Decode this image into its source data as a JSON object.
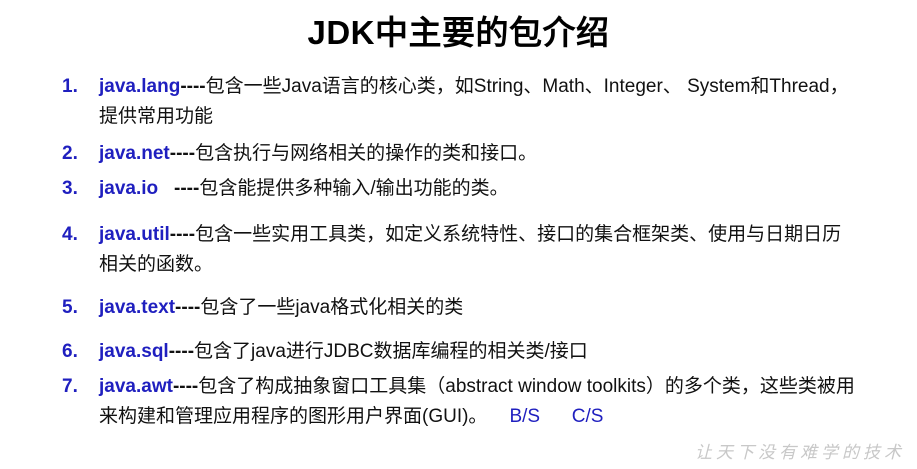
{
  "title": "JDK中主要的包介绍",
  "items": [
    {
      "num": "1.",
      "pkg": "java.lang",
      "dash": "----",
      "desc": "包含一些Java语言的核心类，如String、Math、Integer、 System和Thread，提供常用功能",
      "extra": ""
    },
    {
      "num": "2.",
      "pkg": "java.net",
      "dash": "----",
      "desc": "包含执行与网络相关的操作的类和接口。",
      "extra": ""
    },
    {
      "num": "3.",
      "pkg": "java.io",
      "dash": "   ----",
      "desc": "包含能提供多种输入/输出功能的类。",
      "extra": ""
    },
    {
      "num": "4.",
      "pkg": "java.util",
      "dash": "----",
      "desc": "包含一些实用工具类，如定义系统特性、接口的集合框架类、使用与日期日历相关的函数。",
      "extra": ""
    },
    {
      "num": "5.",
      "pkg": "java.text",
      "dash": "----",
      "desc": "包含了一些java格式化相关的类",
      "extra": ""
    },
    {
      "num": "6.",
      "pkg": "java.sql",
      "dash": "----",
      "desc": "包含了java进行JDBC数据库编程的相关类/接口",
      "extra": ""
    },
    {
      "num": "7.",
      "pkg": "java.awt",
      "dash": "----",
      "desc": "包含了构成抽象窗口工具集（abstract window toolkits）的多个类，这些类被用来构建和管理应用程序的图形用户界面(GUI)。",
      "extra": "B/S      C/S"
    }
  ],
  "watermark": "让天下没有难学的技术"
}
